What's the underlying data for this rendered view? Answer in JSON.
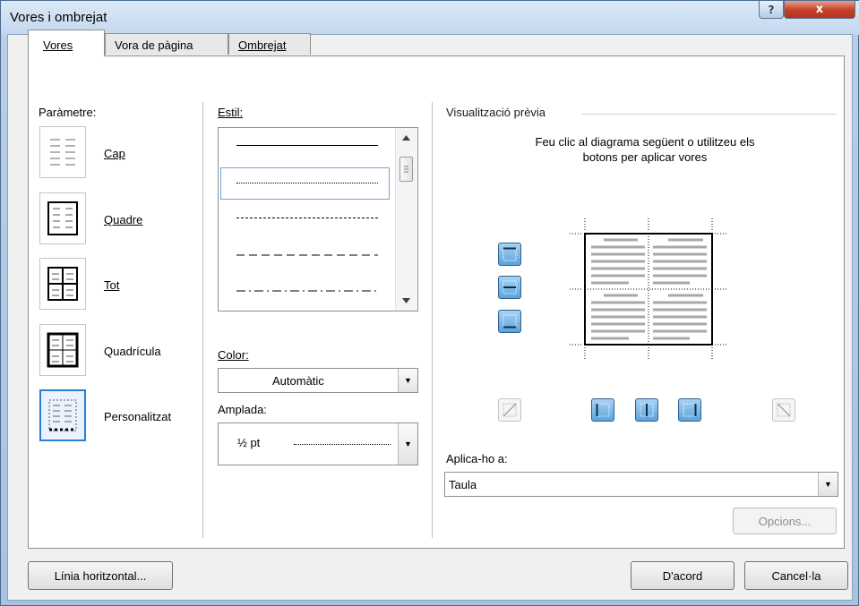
{
  "window": {
    "title": "Vores i ombrejat",
    "help_label": "?",
    "close_label": "x"
  },
  "tabs": [
    {
      "label": "Vores",
      "active": true
    },
    {
      "label": "Vora de pàgina",
      "active": false
    },
    {
      "label": "Ombrejat",
      "active": false
    }
  ],
  "setting": {
    "heading": "Paràmetre:",
    "items": [
      {
        "label": "Cap",
        "icon": "none-border-icon",
        "selected": false
      },
      {
        "label": "Quadre",
        "icon": "box-border-icon",
        "selected": false
      },
      {
        "label": "Tot",
        "icon": "all-borders-icon",
        "selected": false
      },
      {
        "label": "Quadrícula",
        "icon": "grid-border-icon",
        "selected": false
      },
      {
        "label": "Personalitzat",
        "icon": "custom-border-icon",
        "selected": true
      }
    ]
  },
  "style": {
    "heading": "Estil:",
    "lines": [
      "solid",
      "dotted",
      "dashed-fine",
      "dashed",
      "dash-dot"
    ],
    "selected_index": 1
  },
  "color": {
    "label": "Color:",
    "value": "Automàtic"
  },
  "width": {
    "label": "Amplada:",
    "value": "½ pt"
  },
  "preview": {
    "heading": "Visualització prèvia",
    "instructions": "Feu clic al diagrama següent o utilitzeu els botons per aplicar vores"
  },
  "apply_to": {
    "label": "Aplica-ho a:",
    "value": "Taula"
  },
  "buttons": {
    "options": "Opcions...",
    "horizontal_line": "Línia horitzontal...",
    "ok": "D'acord",
    "cancel": "Cancel·la"
  },
  "colors": {
    "accent": "#2a7fd4",
    "close": "#c7442c",
    "border_button": "#5aa3dc"
  }
}
